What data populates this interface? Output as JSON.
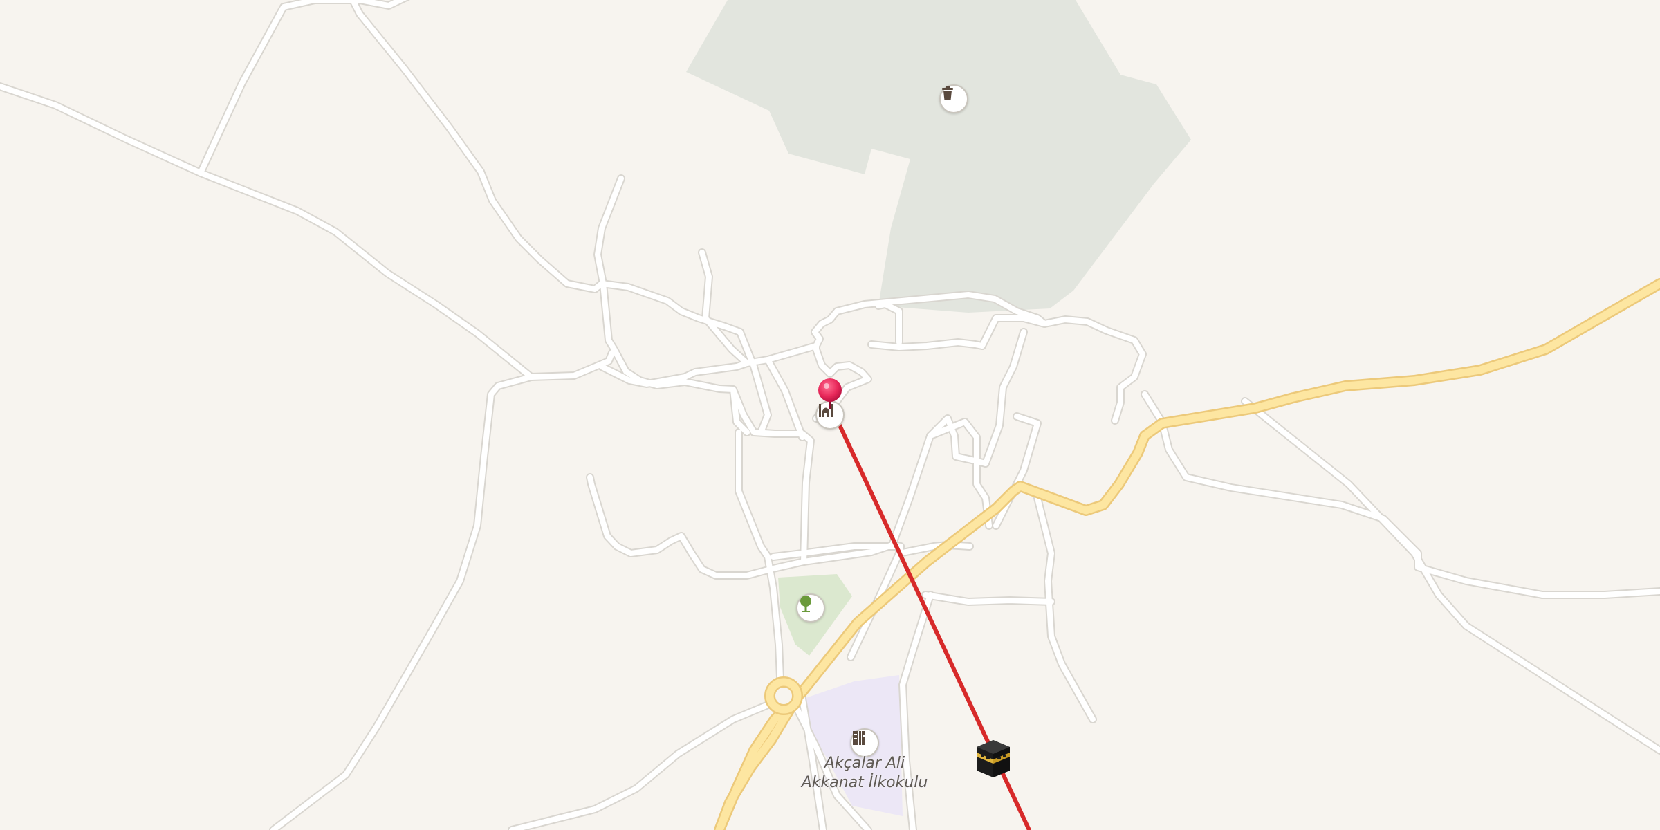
{
  "map": {
    "area_label_line1": "Akçalar Ali",
    "area_label_line2": "Akkanat İlkokulu",
    "pois": [
      {
        "name": "trash-bin-poi-icon",
        "kind": "waste"
      },
      {
        "name": "mosque-poi-icon",
        "kind": "mosque"
      },
      {
        "name": "park-tree-poi-icon",
        "kind": "park"
      },
      {
        "name": "school-poi-icon",
        "kind": "school"
      }
    ],
    "markers": {
      "location_pin": "location-pin-icon",
      "qibla_target": "kaaba-icon"
    },
    "colors": {
      "background": "#f7f4ef",
      "road": "#ffffff",
      "road_casing": "#d9d6d0",
      "major_road": "#fde6a1",
      "major_road_casing": "#ecc97a",
      "forest_area": "#e2e5de",
      "park_area": "#dbe8cf",
      "school_area": "#ece7f6",
      "qibla_line": "#d72a2a",
      "pin": "#e8285a"
    }
  }
}
